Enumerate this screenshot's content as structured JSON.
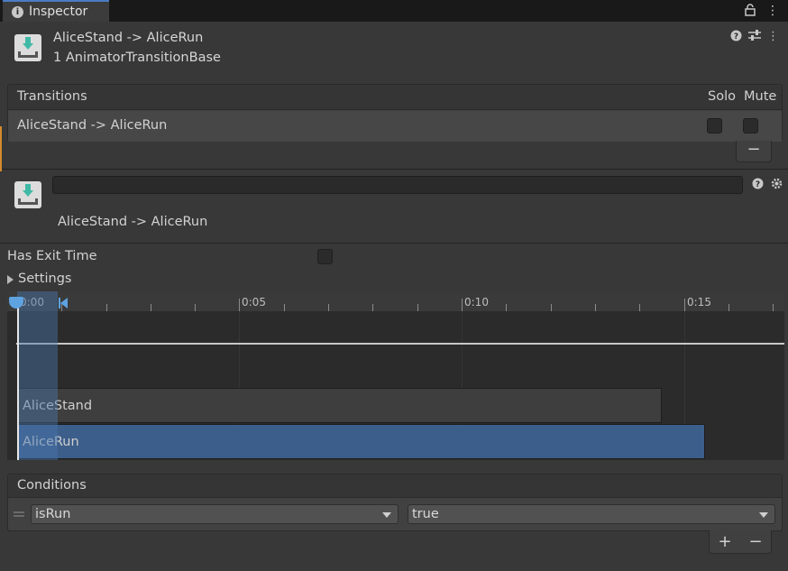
{
  "tab": {
    "label": "Inspector",
    "lock_icon": "lock-icon",
    "menu_icon": "kebab-menu-icon"
  },
  "header": {
    "title": "AliceStand -> AliceRun",
    "subtitle": "1 AnimatorTransitionBase",
    "icon": "animator-transition-icon",
    "tools": [
      "help-icon",
      "preset-icon",
      "kebab-menu-icon"
    ]
  },
  "transitions": {
    "title": "Transitions",
    "solo_label": "Solo",
    "mute_label": "Mute",
    "rows": [
      {
        "label": "AliceStand -> AliceRun",
        "solo": false,
        "mute": false
      }
    ],
    "remove_label": "−"
  },
  "transition_detail": {
    "name_value": "",
    "label": "AliceStand -> AliceRun",
    "has_exit_time_label": "Has Exit Time",
    "has_exit_time": false,
    "settings_label": "Settings",
    "tools": [
      "help-icon",
      "gear-icon"
    ]
  },
  "timeline": {
    "tick_labels": [
      "0:00",
      "0:05",
      "0:10",
      "0:15"
    ],
    "states": [
      {
        "name": "AliceStand"
      },
      {
        "name": "AliceRun"
      }
    ]
  },
  "conditions": {
    "title": "Conditions",
    "rows": [
      {
        "parameter": "isRun",
        "value": "true"
      }
    ],
    "add_label": "+",
    "remove_label": "−"
  },
  "colors": {
    "accent": "#4a7cc2",
    "run_bar": "#3c5e8a",
    "background": "#383838"
  }
}
